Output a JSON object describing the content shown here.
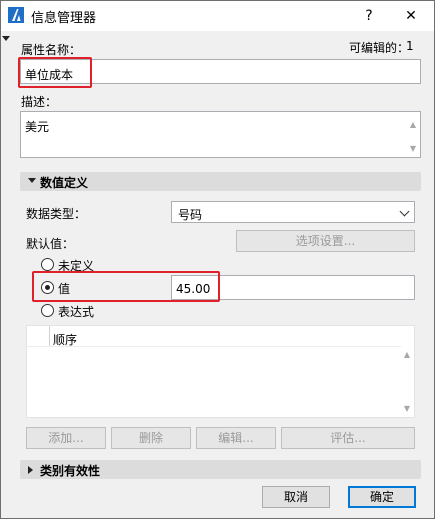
{
  "window": {
    "title": "信息管理器",
    "help_icon": "?",
    "close_icon": "✕"
  },
  "name_field": {
    "label": "属性名称：",
    "editable_label": "可编辑的：",
    "editable_count": "1",
    "value": "单位成本"
  },
  "description": {
    "label": "描述：",
    "value": "美元"
  },
  "value_definition": {
    "header": "数值定义",
    "data_type_label": "数据类型：",
    "data_type_value": "号码",
    "default_label": "默认值：",
    "options_button": "选项设置...",
    "radio_undefined": "未定义",
    "radio_value": "值",
    "value_input": "45.00",
    "radio_expression": "表达式",
    "list_column": "顺序",
    "buttons": {
      "add": "添加...",
      "delete": "删除",
      "edit": "编辑...",
      "evaluate": "评估..."
    }
  },
  "category_validity": {
    "header": "类别有效性"
  },
  "footer": {
    "cancel": "取消",
    "ok": "确定"
  },
  "colors": {
    "highlight": "#e0202a",
    "accent": "#0078d7"
  }
}
